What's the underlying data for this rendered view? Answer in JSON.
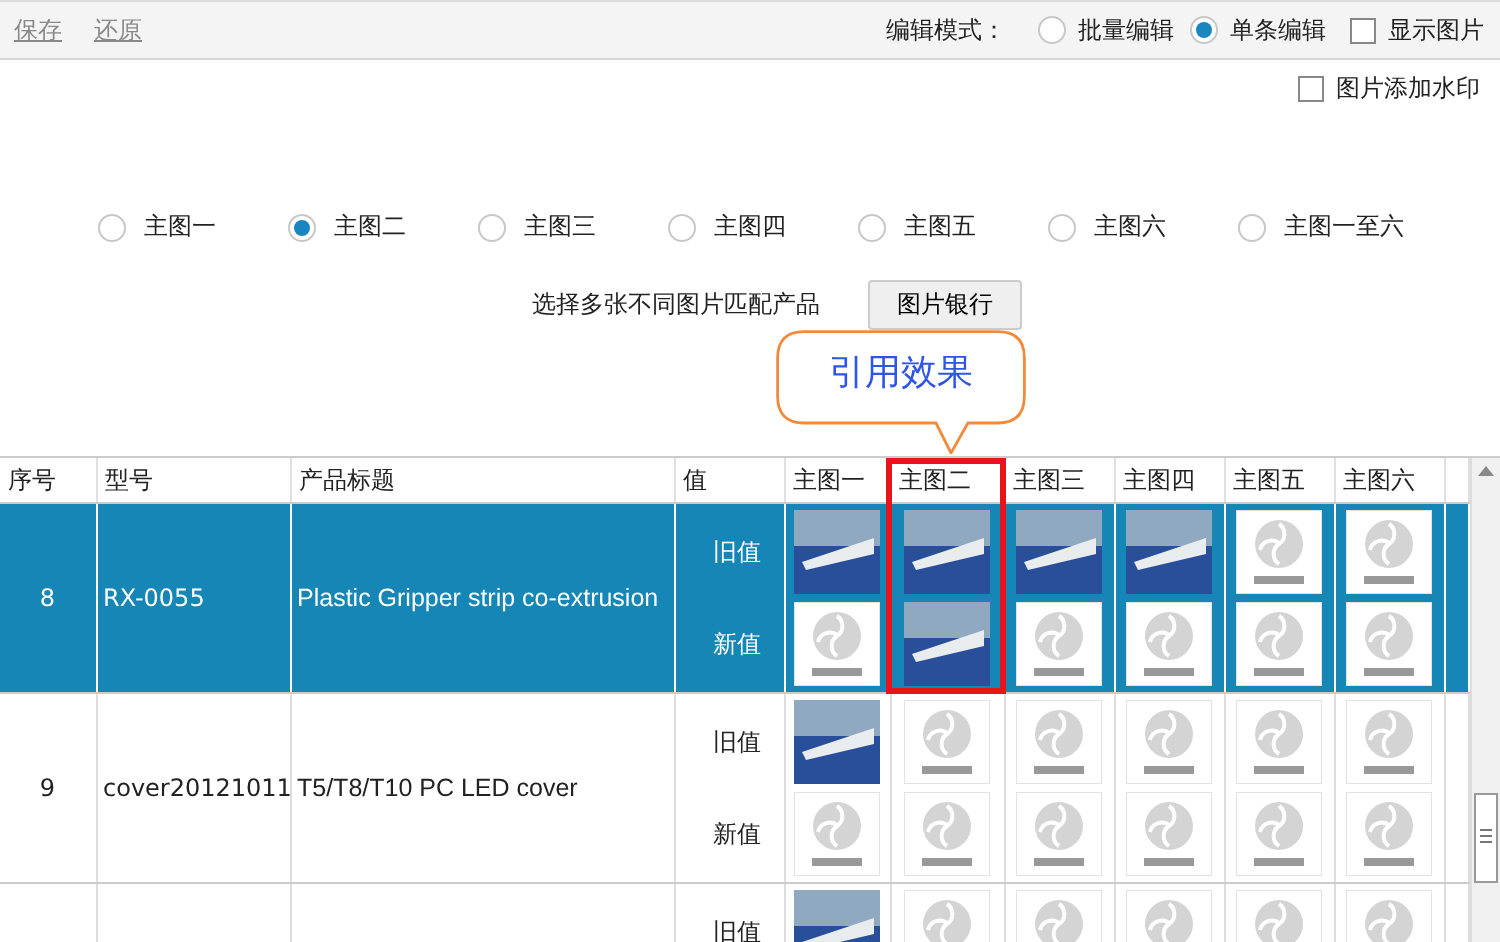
{
  "toolbar": {
    "actions": [
      {
        "label": "保存"
      },
      {
        "label": "还原"
      }
    ],
    "edit_mode_label": "编辑模式：",
    "modes": [
      {
        "label": "批量编辑",
        "selected": false
      },
      {
        "label": "单条编辑",
        "selected": true
      }
    ],
    "show_images": {
      "label": "显示图片",
      "checked": false
    }
  },
  "watermark": {
    "label": "图片添加水印",
    "checked": false
  },
  "image_choices": [
    {
      "label": "主图一",
      "selected": false
    },
    {
      "label": "主图二",
      "selected": true
    },
    {
      "label": "主图三",
      "selected": false
    },
    {
      "label": "主图四",
      "selected": false
    },
    {
      "label": "主图五",
      "selected": false
    },
    {
      "label": "主图六",
      "selected": false
    },
    {
      "label": "主图一至六",
      "selected": false
    }
  ],
  "match_hint": "选择多张不同图片匹配产品",
  "image_bank_button": "图片银行",
  "callout": {
    "text": "引用效果"
  },
  "table": {
    "columns": [
      {
        "label": "序号",
        "highlighted": false
      },
      {
        "label": "型号",
        "highlighted": false
      },
      {
        "label": "产品标题",
        "highlighted": false
      },
      {
        "label": "值",
        "highlighted": false
      },
      {
        "label": "主图一",
        "highlighted": false
      },
      {
        "label": "主图二",
        "highlighted": true
      },
      {
        "label": "主图三",
        "highlighted": false
      },
      {
        "label": "主图四",
        "highlighted": false
      },
      {
        "label": "主图五",
        "highlighted": false
      },
      {
        "label": "主图六",
        "highlighted": false
      }
    ],
    "rows": [
      {
        "index": "8",
        "model": "RX-0055",
        "title": "Plastic Gripper strip co-extrusion",
        "selected": true,
        "values": [
          {
            "label": "旧值",
            "images": [
              {
                "kind": "photo"
              },
              {
                "kind": "photo"
              },
              {
                "kind": "photo"
              },
              {
                "kind": "photo"
              },
              {
                "kind": "none"
              },
              {
                "kind": "none"
              }
            ]
          },
          {
            "label": "新值",
            "images": [
              {
                "kind": "none"
              },
              {
                "kind": "photo"
              },
              {
                "kind": "none"
              },
              {
                "kind": "none"
              },
              {
                "kind": "none"
              },
              {
                "kind": "none"
              }
            ]
          }
        ]
      },
      {
        "index": "9",
        "model": "cover20121011",
        "title": "T5/T8/T10 PC LED cover",
        "selected": false,
        "values": [
          {
            "label": "旧值",
            "images": [
              {
                "kind": "photo"
              },
              {
                "kind": "none"
              },
              {
                "kind": "none"
              },
              {
                "kind": "none"
              },
              {
                "kind": "none"
              },
              {
                "kind": "none"
              }
            ]
          },
          {
            "label": "新值",
            "images": [
              {
                "kind": "none"
              },
              {
                "kind": "none"
              },
              {
                "kind": "none"
              },
              {
                "kind": "none"
              },
              {
                "kind": "none"
              },
              {
                "kind": "none"
              }
            ]
          }
        ]
      },
      {
        "selected": false,
        "values": [
          {
            "label": "旧值",
            "images": [
              {
                "kind": "photo"
              },
              {
                "kind": "none"
              },
              {
                "kind": "none"
              },
              {
                "kind": "none"
              },
              {
                "kind": "none"
              },
              {
                "kind": "none"
              }
            ]
          }
        ]
      }
    ]
  }
}
